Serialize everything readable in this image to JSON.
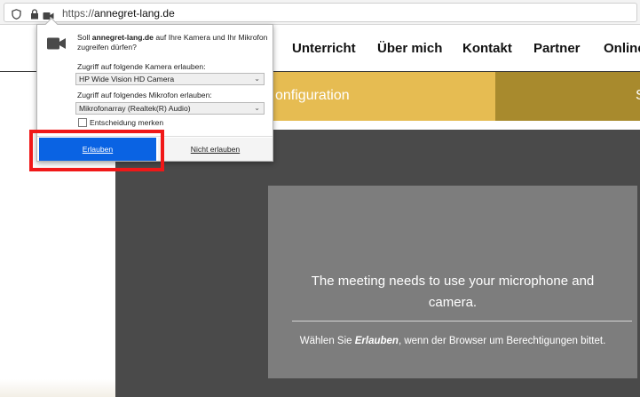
{
  "browser": {
    "url_scheme": "https://",
    "url_host": "annegret-lang.de"
  },
  "site": {
    "nav": [
      "Unterricht",
      "Über mich",
      "Kontakt",
      "Partner",
      "Online"
    ],
    "banner_text": "onfiguration",
    "banner_right_glyph": "S",
    "accent_color": "#e6bc52",
    "accent_dark": "#a88a2d",
    "card": {
      "title": "The meeting needs to use your microphone and camera.",
      "sub_prefix": "Wählen Sie ",
      "sub_bold": "Erlauben",
      "sub_suffix": ", wenn der Browser um Berechtigungen bittet."
    }
  },
  "permission": {
    "msg_prefix": "Soll ",
    "msg_host": "annegret-lang.de",
    "msg_suffix": " auf Ihre Kamera und Ihr Mikrofon zugreifen dürfen?",
    "camera_label": "Zugriff auf folgende Kamera erlauben:",
    "camera_value": "HP Wide Vision HD Camera",
    "mic_label": "Zugriff auf folgendes Mikrofon erlauben:",
    "mic_value": "Mikrofonarray (Realtek(R) Audio)",
    "remember_label": "Entscheidung merken",
    "allow_label": "Erlauben",
    "deny_label": "Nicht erlauben",
    "allow_color": "#0a63e3"
  },
  "highlight_color": "#f01818"
}
